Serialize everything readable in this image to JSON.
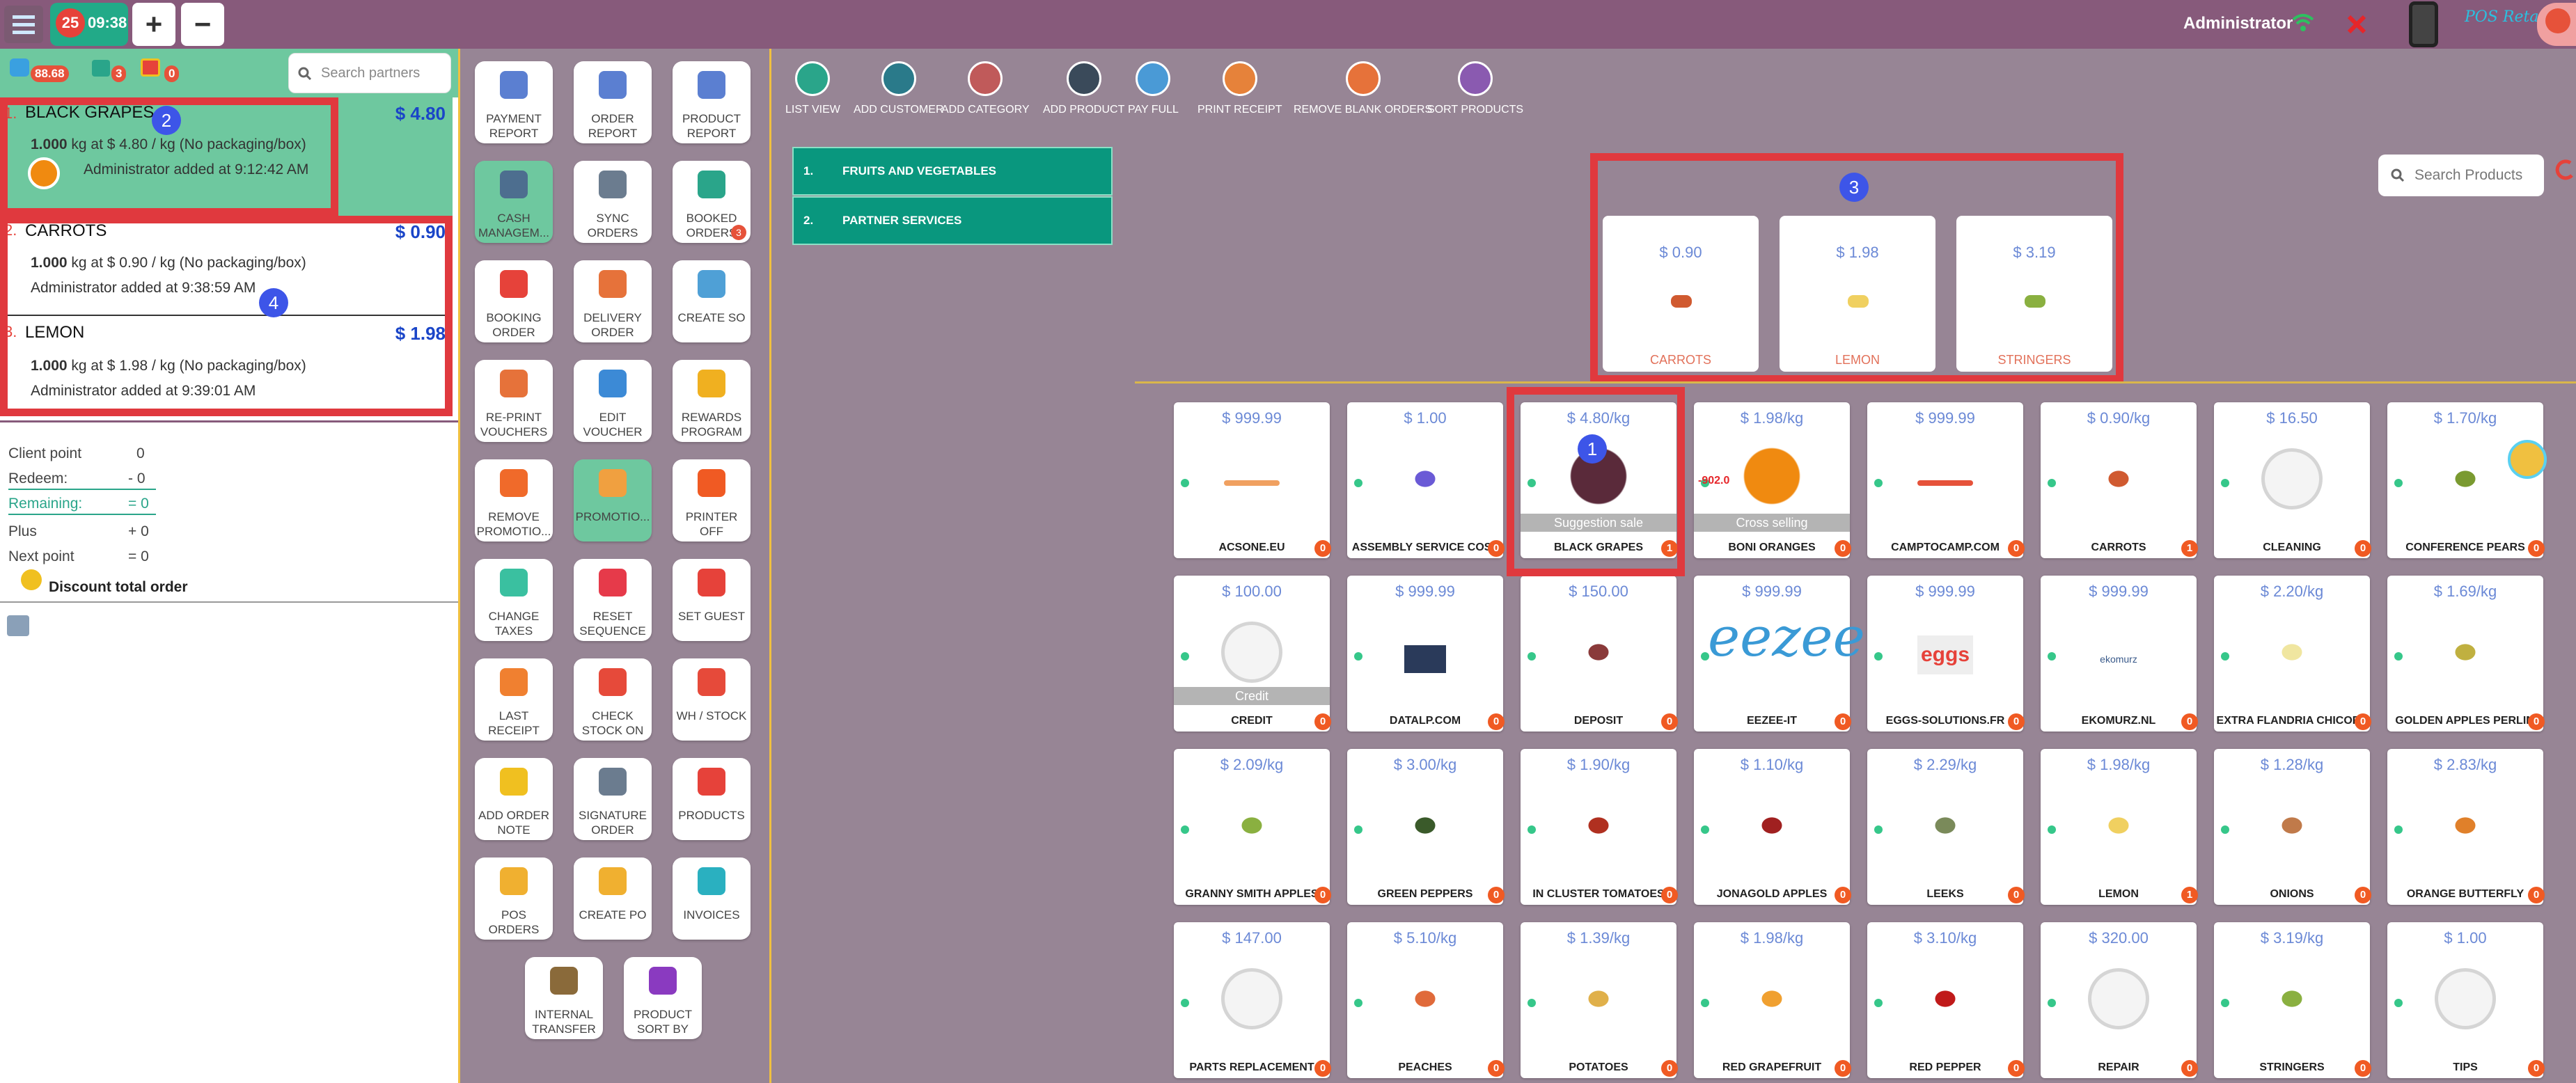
{
  "topbar": {
    "badge": "25",
    "time": "09:38",
    "plus": "+",
    "minus": "−",
    "user": "Administrator",
    "brand": "POS Retail"
  },
  "left": {
    "chips": {
      "points": "88.68",
      "cart": "3",
      "gift": "0"
    },
    "search_placeholder": "Search partners",
    "lines": [
      {
        "idx": "1.",
        "name": "BLACK GRAPES",
        "price": "$ 4.80",
        "qty_bold": "1.000",
        "qty_rest": " kg at $ 4.80 / kg (No packaging/box)",
        "by": "Administrator added at 9:12:42 AM"
      },
      {
        "idx": "2.",
        "name": "CARROTS",
        "price": "$ 0.90",
        "qty_bold": "1.000",
        "qty_rest": " kg at $ 0.90 / kg (No packaging/box)",
        "by": "Administrator added at 9:38:59 AM"
      },
      {
        "idx": "3.",
        "name": "LEMON",
        "price": "$ 1.98",
        "qty_bold": "1.000",
        "qty_rest": " kg at $ 1.98 / kg (No packaging/box)",
        "by": "Administrator added at 9:39:01 AM"
      }
    ],
    "points": [
      {
        "label": "Client point",
        "value": "0"
      },
      {
        "label": "Redeem:",
        "value": "- 0"
      },
      {
        "label": "Remaining:",
        "value": "= 0"
      },
      {
        "label": "Plus",
        "value": "+ 0"
      },
      {
        "label": "Next point",
        "value": "= 0"
      }
    ],
    "discount": "Discount total order"
  },
  "annotations": {
    "a1": "1",
    "a2": "2",
    "a3": "3",
    "a4": "4"
  },
  "controls": [
    {
      "l1": "PAYMENT",
      "l2": "REPORT",
      "color": "#5b7fd1"
    },
    {
      "l1": "ORDER",
      "l2": "REPORT",
      "color": "#5b7fd1"
    },
    {
      "l1": "PRODUCT",
      "l2": "REPORT",
      "color": "#5b7fd1"
    },
    {
      "l1": "CASH",
      "l2": "MANAGEM...",
      "color": "#4d6e8f",
      "green": true
    },
    {
      "l1": "SYNC",
      "l2": "ORDERS",
      "color": "#6b7c8f"
    },
    {
      "l1": "BOOKED",
      "l2": "ORDERS",
      "color": "#2aa58a",
      "badge": "3"
    },
    {
      "l1": "BOOKING",
      "l2": "ORDER",
      "color": "#e6423a"
    },
    {
      "l1": "DELIVERY",
      "l2": "ORDER",
      "color": "#e6723a"
    },
    {
      "l1": "CREATE SO",
      "l2": "",
      "color": "#4fa0d6"
    },
    {
      "l1": "RE-PRINT",
      "l2": "VOUCHERS",
      "color": "#e6723a"
    },
    {
      "l1": "EDIT",
      "l2": "VOUCHER",
      "color": "#3c8ad6"
    },
    {
      "l1": "REWARDS",
      "l2": "PROGRAM",
      "color": "#f0b020"
    },
    {
      "l1": "REMOVE",
      "l2": "PROMOTIO...",
      "color": "#f06a2a"
    },
    {
      "l1": "PROMOTIO...",
      "l2": "",
      "color": "#f0a040",
      "green": true
    },
    {
      "l1": "PRINTER",
      "l2": "OFF",
      "color": "#f05a23"
    },
    {
      "l1": "CHANGE",
      "l2": "TAXES",
      "color": "#3ac0a0"
    },
    {
      "l1": "RESET",
      "l2": "SEQUENCE",
      "color": "#e63a4a"
    },
    {
      "l1": "SET GUEST",
      "l2": "",
      "color": "#e6423a"
    },
    {
      "l1": "LAST",
      "l2": "RECEIPT",
      "color": "#f08030"
    },
    {
      "l1": "CHECK",
      "l2": "STOCK ON",
      "color": "#e64a3a"
    },
    {
      "l1": "WH / STOCK",
      "l2": "",
      "color": "#e64a3a"
    },
    {
      "l1": "ADD ORDER",
      "l2": "NOTE",
      "color": "#f0c020"
    },
    {
      "l1": "SIGNATURE",
      "l2": "ORDER",
      "color": "#6b7c8f"
    },
    {
      "l1": "PRODUCTS",
      "l2": "",
      "color": "#e6423a"
    },
    {
      "l1": "POS",
      "l2": "ORDERS",
      "color": "#f0b030"
    },
    {
      "l1": "CREATE PO",
      "l2": "",
      "color": "#f0b030"
    },
    {
      "l1": "INVOICES",
      "l2": "",
      "color": "#2ab0c0"
    },
    {
      "l1": "INTERNAL",
      "l2": "TRANSFER",
      "color": "#8a6a3a"
    },
    {
      "l1": "PRODUCT",
      "l2": "SORT BY",
      "color": "#8a3ac0"
    }
  ],
  "toolbar": [
    {
      "label": "LIST VIEW",
      "color": "#2aa58a"
    },
    {
      "label": "ADD CUSTOMER",
      "color": "#2a7a8a"
    },
    {
      "label": "ADD CATEGORY",
      "color": "#c05a5a"
    },
    {
      "label": "ADD PRODUCT",
      "color": "#3a4a5a"
    },
    {
      "label": "PAY FULL",
      "color": "#4a9ad6"
    },
    {
      "label": "PRINT RECEIPT",
      "color": "#e6823a"
    },
    {
      "label": "REMOVE BLANK ORDERS",
      "color": "#e6723a"
    },
    {
      "label": "SORT PRODUCTS",
      "color": "#8a5ab0"
    }
  ],
  "categories": [
    {
      "idx": "1.",
      "name": "FRUITS AND VEGETABLES"
    },
    {
      "idx": "2.",
      "name": "PARTNER SERVICES"
    }
  ],
  "search_products_placeholder": "Search Products",
  "suggestions": [
    {
      "price": "$ 0.90",
      "name": "CARROTS",
      "color": "#d05a30"
    },
    {
      "price": "$ 1.98",
      "name": "LEMON",
      "color": "#f0d060"
    },
    {
      "price": "$ 3.19",
      "name": "STRINGERS",
      "color": "#8ab040"
    }
  ],
  "products": [
    {
      "price": "$ 999.99",
      "name": "ACSONE.EU",
      "qty": "0",
      "img": "logo",
      "color": "#f0a060"
    },
    {
      "price": "$ 1.00",
      "name": "ASSEMBLY SERVICE COST",
      "qty": "0",
      "img": "icon",
      "color": "#6a5ad6"
    },
    {
      "price": "$ 4.80/kg",
      "name": "BLACK GRAPES",
      "qty": "1",
      "img": "big",
      "color": "#5a2a3a",
      "tag": "Suggestion sale"
    },
    {
      "price": "$ 1.98/kg",
      "name": "BONI ORANGES",
      "qty": "0",
      "img": "big",
      "color": "#f08a10",
      "tag": "Cross selling",
      "stock": "-902.0"
    },
    {
      "price": "$ 999.99",
      "name": "CAMPTOCAMP.COM",
      "qty": "0",
      "img": "logo",
      "color": "#e6523a"
    },
    {
      "price": "$ 0.90/kg",
      "name": "CARROTS",
      "qty": "1",
      "img": "icon",
      "color": "#d05a30"
    },
    {
      "price": "$ 16.50",
      "name": "CLEANING",
      "qty": "0",
      "img": "none"
    },
    {
      "price": "$ 1.70/kg",
      "name": "CONFERENCE PEARS",
      "qty": "0",
      "img": "icon",
      "color": "#7a9a30"
    },
    {
      "price": "$ 100.00",
      "name": "CREDIT",
      "qty": "0",
      "img": "none",
      "tag": "Credit"
    },
    {
      "price": "$ 999.99",
      "name": "DATALP.COM",
      "qty": "0",
      "img": "photo",
      "color": "#2a3a5a"
    },
    {
      "price": "$ 150.00",
      "name": "DEPOSIT",
      "qty": "0",
      "img": "icon",
      "color": "#8a3a3a"
    },
    {
      "price": "$ 999.99",
      "name": "EEZEE-IT",
      "qty": "0",
      "img": "eezee",
      "color": "#3a9ad6",
      "logo": "eezee",
      "sub": "EEZEE IT"
    },
    {
      "price": "$ 999.99",
      "name": "EGGS-SOLUTIONS.FR",
      "qty": "0",
      "img": "eggs",
      "color": "#e6423a",
      "logo": "eggs"
    },
    {
      "price": "$ 999.99",
      "name": "EKOMURZ.NL",
      "qty": "0",
      "img": "text",
      "color": "#3a5a8a",
      "logo": "ekomurz"
    },
    {
      "price": "$ 2.20/kg",
      "name": "EXTRA FLANDRIA CHICORY",
      "qty": "0",
      "img": "icon",
      "color": "#f0e6a0"
    },
    {
      "price": "$ 1.69/kg",
      "name": "GOLDEN APPLES PERLIM",
      "qty": "0",
      "img": "icon",
      "color": "#c0b040"
    },
    {
      "price": "$ 2.09/kg",
      "name": "GRANNY SMITH APPLES",
      "qty": "0",
      "img": "icon",
      "color": "#8ab040"
    },
    {
      "price": "$ 3.00/kg",
      "name": "GREEN PEPPERS",
      "qty": "0",
      "img": "icon",
      "color": "#3a5a2a"
    },
    {
      "price": "$ 1.90/kg",
      "name": "IN CLUSTER TOMATOES",
      "qty": "0",
      "img": "icon",
      "color": "#b03020"
    },
    {
      "price": "$ 1.10/kg",
      "name": "JONAGOLD APPLES",
      "qty": "0",
      "img": "icon",
      "color": "#a02020"
    },
    {
      "price": "$ 2.29/kg",
      "name": "LEEKS",
      "qty": "0",
      "img": "icon",
      "color": "#7a8a5a"
    },
    {
      "price": "$ 1.98/kg",
      "name": "LEMON",
      "qty": "1",
      "img": "icon",
      "color": "#f0d060"
    },
    {
      "price": "$ 1.28/kg",
      "name": "ONIONS",
      "qty": "0",
      "img": "icon",
      "color": "#c07a4a"
    },
    {
      "price": "$ 2.83/kg",
      "name": "ORANGE BUTTERFLY",
      "qty": "0",
      "img": "icon",
      "color": "#e0802a"
    },
    {
      "price": "$ 147.00",
      "name": "PARTS REPLACEMENT",
      "qty": "0",
      "img": "none"
    },
    {
      "price": "$ 5.10/kg",
      "name": "PEACHES",
      "qty": "0",
      "img": "icon",
      "color": "#e06a3a"
    },
    {
      "price": "$ 1.39/kg",
      "name": "POTATOES",
      "qty": "0",
      "img": "icon",
      "color": "#e0b04a"
    },
    {
      "price": "$ 1.98/kg",
      "name": "RED GRAPEFRUIT",
      "qty": "0",
      "img": "icon",
      "color": "#f0a030"
    },
    {
      "price": "$ 3.10/kg",
      "name": "RED PEPPER",
      "qty": "0",
      "img": "icon",
      "color": "#c01a1a"
    },
    {
      "price": "$ 320.00",
      "name": "REPAIR",
      "qty": "0",
      "img": "none"
    },
    {
      "price": "$ 3.19/kg",
      "name": "STRINGERS",
      "qty": "0",
      "img": "icon",
      "color": "#8ab040"
    },
    {
      "price": "$ 1.00",
      "name": "TIPS",
      "qty": "0",
      "img": "none"
    }
  ]
}
